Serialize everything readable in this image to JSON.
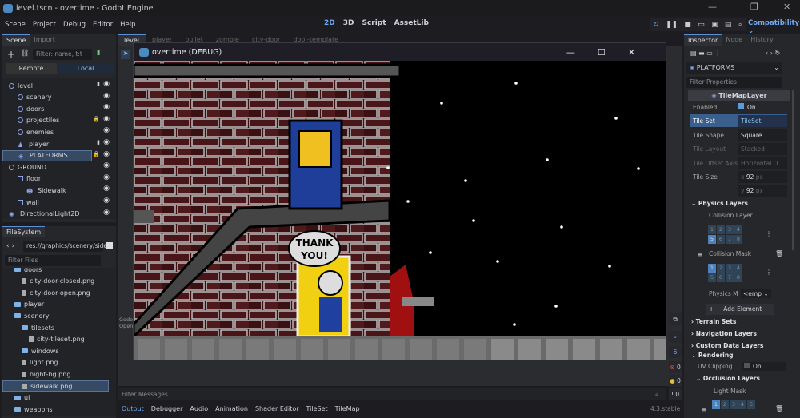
{
  "window": {
    "title": "level.tscn - overtime - Godot Engine",
    "min": "—",
    "max": "❐",
    "close": "✕"
  },
  "menu": [
    "Scene",
    "Project",
    "Debug",
    "Editor",
    "Help"
  ],
  "modes": [
    "2D",
    "3D",
    "Script",
    "AssetLib"
  ],
  "renderer": "Compatibility",
  "scene_dock": {
    "tabs": [
      "Scene",
      "Import"
    ],
    "filter_placeholder": "Filter: name, t:t",
    "remote": "Remote",
    "local": "Local",
    "nodes": [
      {
        "name": "level",
        "depth": 0,
        "icon": "node2d-icon",
        "extra": "script-icon"
      },
      {
        "name": "scenery",
        "depth": 1,
        "icon": "node2d-icon"
      },
      {
        "name": "doors",
        "depth": 1,
        "icon": "node2d-icon"
      },
      {
        "name": "projectiles",
        "depth": 1,
        "icon": "node2d-icon",
        "extra": "lock-icon"
      },
      {
        "name": "enemies",
        "depth": 1,
        "icon": "node2d-icon"
      },
      {
        "name": "player",
        "depth": 1,
        "icon": "character-icon",
        "extra": "script-icon"
      },
      {
        "name": "PLATFORMS",
        "depth": 1,
        "icon": "tilemap-icon",
        "extra": "lock-icon",
        "selected": true
      },
      {
        "name": "GROUND",
        "depth": 0,
        "icon": "node-icon"
      },
      {
        "name": "floor",
        "depth": 1,
        "icon": "square-icon"
      },
      {
        "name": "Sidewalk",
        "depth": 2,
        "icon": "sprite-icon"
      },
      {
        "name": "wall",
        "depth": 1,
        "icon": "square-icon"
      },
      {
        "name": "DirectionalLight2D",
        "depth": 0,
        "icon": "light-icon"
      }
    ]
  },
  "filesystem": {
    "tab": "FileSystem",
    "path": "res://graphics/scenery/side",
    "filter_placeholder": "Filter Files",
    "items": [
      {
        "name": "doors",
        "depth": 1,
        "folder": true
      },
      {
        "name": "city-door-closed.png",
        "depth": 2
      },
      {
        "name": "city-door-open.png",
        "depth": 2
      },
      {
        "name": "player",
        "depth": 1,
        "folder": true
      },
      {
        "name": "scenery",
        "depth": 1,
        "folder": true
      },
      {
        "name": "tilesets",
        "depth": 2,
        "folder": true
      },
      {
        "name": "city-tileset.png",
        "depth": 3
      },
      {
        "name": "windows",
        "depth": 2,
        "folder": true
      },
      {
        "name": "light.png",
        "depth": 2
      },
      {
        "name": "night-bg.png",
        "depth": 2
      },
      {
        "name": "sidewalk.png",
        "depth": 2,
        "selected": true
      },
      {
        "name": "ui",
        "depth": 1,
        "folder": true
      },
      {
        "name": "weapons",
        "depth": 1,
        "folder": true
      }
    ]
  },
  "scene_tabs": [
    "level",
    "player",
    "bullet",
    "zombie",
    "city-door",
    "door-template"
  ],
  "game_window": {
    "title": "overtime (DEBUG)",
    "speech": [
      "THANK",
      "YOU!"
    ]
  },
  "output_text": [
    "Godo",
    "Open"
  ],
  "bottom": {
    "filter_placeholder": "Filter Messages",
    "tabs": [
      "Output",
      "Debugger",
      "Audio",
      "Animation",
      "Shader Editor",
      "TileSet",
      "TileMap"
    ],
    "version": "4.3.stable",
    "counts": {
      "errors": "0",
      "warnings": "0",
      "messages": "0",
      "filter": "6"
    }
  },
  "inspector": {
    "tabs": [
      "Inspector",
      "Node",
      "History"
    ],
    "node": "PLATFORMS",
    "filter_placeholder": "Filter Properties",
    "class": "TileMapLayer",
    "enabled_label": "Enabled",
    "enabled_value": "On",
    "tile_set_label": "Tile Set",
    "tile_set_value": "TileSet",
    "tile_shape_label": "Tile Shape",
    "tile_shape": "Square",
    "tile_layout_label": "Tile Layout",
    "tile_layout": "Stacked",
    "tile_offset_label": "Tile Offset Axis",
    "tile_offset": "Horizontal O",
    "tile_size_label": "Tile Size",
    "tile_size_x": "92",
    "tile_size_y": "92",
    "px": "px",
    "x": "x",
    "y": "y",
    "physics_layers": "Physics Layers",
    "collision_layer": "Collision Layer",
    "collision_mask": "Collision Mask",
    "physics_material_label": "Physics M",
    "physics_material": "<emp",
    "add_element": "Add Element",
    "terrain_sets": "Terrain Sets",
    "navigation_layers": "Navigation Layers",
    "custom_data_layers": "Custom Data Layers",
    "rendering": "Rendering",
    "uv_clipping": "UV Clipping",
    "uv_value": "On",
    "occlusion_layers": "Occlusion Layers",
    "light_mask": "Light Mask",
    "layer_bits": [
      "1",
      "2",
      "3",
      "4",
      "5",
      "6",
      "7",
      "8"
    ],
    "collision_layer_on": "5",
    "collision_mask_on": "1",
    "light_bits": [
      "1",
      "2",
      "3",
      "4",
      "5"
    ]
  },
  "colors": {
    "accent": "#6fa9f0",
    "selected": "#364a63"
  }
}
